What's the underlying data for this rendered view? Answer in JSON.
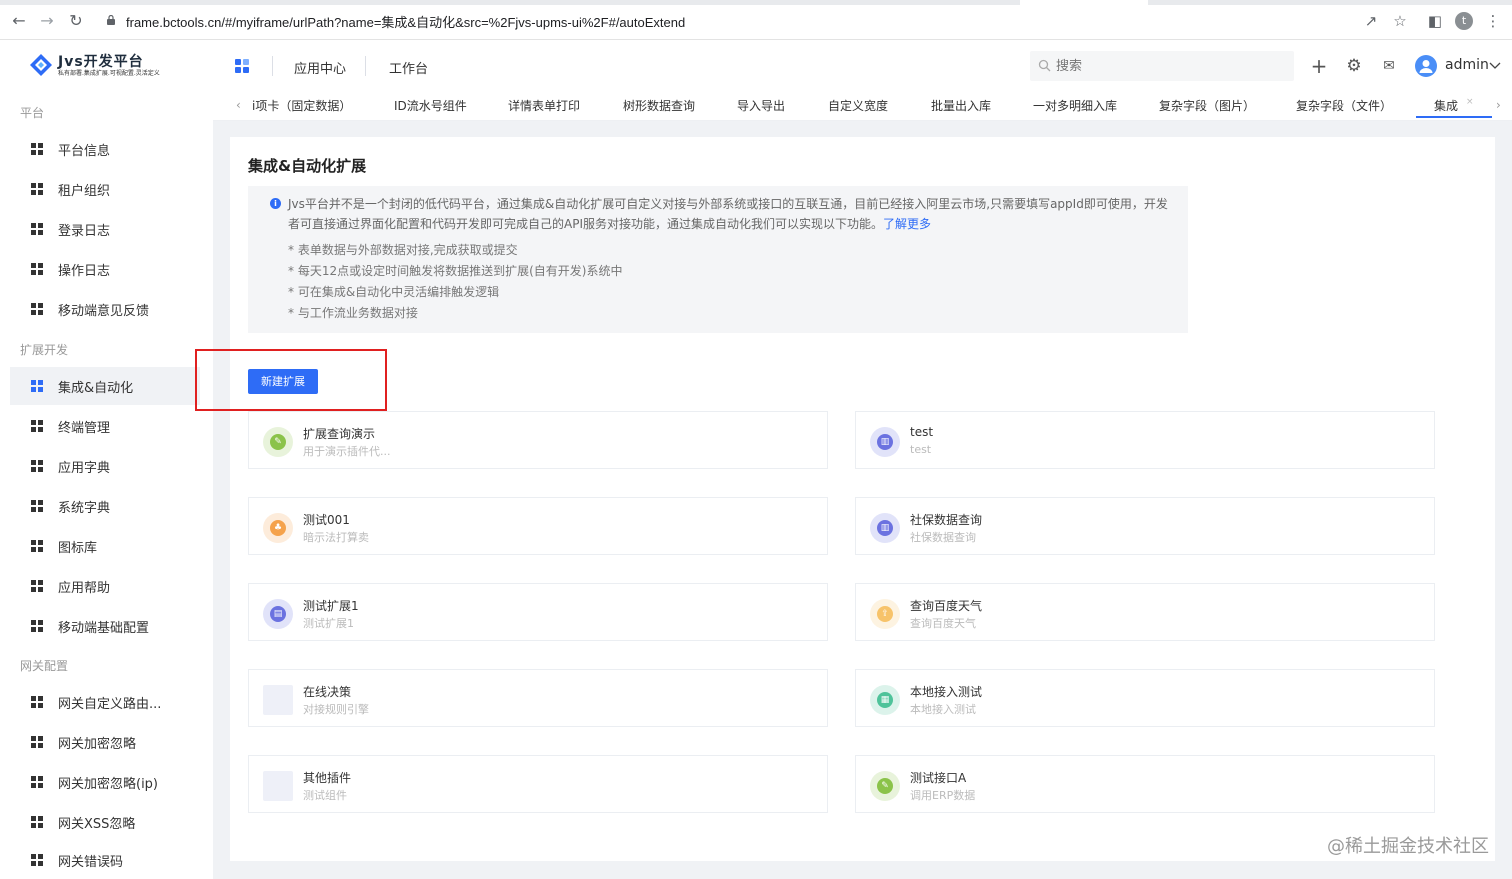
{
  "browser": {
    "url": "frame.bctools.cn/#/myiframe/urlPath?name=集成&自动化&src=%2Fjvs-upms-ui%2F#/autoExtend",
    "profile_initial": "t",
    "icons": [
      "back-icon",
      "forward-icon",
      "reload-icon",
      "lock-icon",
      "share-icon",
      "star-icon",
      "sidepanel-icon",
      "profile-icon",
      "menu-icon"
    ]
  },
  "header": {
    "logo_title": "Jvs开发平台",
    "logo_subtitle": "私有部署.集成扩展.可视配置.灵活定义",
    "nav": [
      "应用中心",
      "工作台"
    ],
    "search_placeholder": "搜索",
    "user_name": "admin",
    "icons": [
      "apps-icon",
      "plus-icon",
      "settings-icon",
      "message-icon",
      "avatar-icon",
      "chevron-down-icon"
    ]
  },
  "tabs": {
    "items": [
      "i项卡（固定数据）",
      "ID流水号组件",
      "详情表单打印",
      "树形数据查询",
      "导入导出",
      "自定义宽度",
      "批量出入库",
      "一对多明细入库",
      "复杂字段（图片）",
      "复杂字段（文件）",
      "集成"
    ],
    "active_index": 10,
    "close": "×"
  },
  "sidebar": {
    "groups": [
      {
        "title": "平台",
        "items": [
          "平台信息",
          "租户组织",
          "登录日志",
          "操作日志",
          "移动端意见反馈"
        ]
      },
      {
        "title": "扩展开发",
        "items": [
          "集成&自动化",
          "终端管理",
          "应用字典",
          "系统字典",
          "图标库",
          "应用帮助",
          "移动端基础配置"
        ]
      },
      {
        "title": "网关配置",
        "items": [
          "网关自定义路由...",
          "网关加密忽略",
          "网关加密忽略(ip)",
          "网关XSS忽略",
          "网关错误码"
        ]
      }
    ],
    "active_item": "集成&自动化"
  },
  "main": {
    "title": "集成&自动化扩展",
    "info": {
      "text": "Jvs平台并不是一个封闭的低代码平台，通过集成&自动化扩展可自定义对接与外部系统或接口的互联互通，目前已经接入阿里云市场,只需要填写appId即可使用，开发者可直接通过界面化配置和代码开发即可完成自己的API服务对接功能，通过集成自动化我们可以实现以下功能。",
      "link": "了解更多",
      "bullets": [
        "* 表单数据与外部数据对接,完成获取或提交",
        "* 每天12点或设定时间触发将数据推送到扩展(自有开发)系统中",
        "* 可在集成&自动化中灵活编排触发逻辑",
        "* 与工作流业务数据对接"
      ]
    },
    "new_button": "新建扩展",
    "cards": [
      {
        "name": "扩展查询演示",
        "desc": "用于演示插件代...",
        "color": "#8bc34a",
        "icon": "chat-icon",
        "glyph": "✎"
      },
      {
        "name": "test",
        "desc": "test",
        "color": "#6b72e0",
        "icon": "chart-icon",
        "glyph": "▥"
      },
      {
        "name": "测试001",
        "desc": "暗示法打算卖",
        "color": "#f5a24b",
        "icon": "people-icon",
        "glyph": "♣"
      },
      {
        "name": "社保数据查询",
        "desc": "社保数据查询",
        "color": "#6b72e0",
        "icon": "chart-icon",
        "glyph": "▥"
      },
      {
        "name": "测试扩展1",
        "desc": "测试扩展1",
        "color": "#6b72e0",
        "icon": "document-icon",
        "glyph": "▤"
      },
      {
        "name": "查询百度天气",
        "desc": "查询百度天气",
        "color": "#f7c36a",
        "icon": "upload-icon",
        "glyph": "⇪"
      },
      {
        "name": "在线决策",
        "desc": "对接规则引擎",
        "color": "",
        "icon": "blank-icon",
        "glyph": ""
      },
      {
        "name": "本地接入测试",
        "desc": "本地接入测试",
        "color": "#4fc39a",
        "icon": "grid-icon",
        "glyph": "▦"
      },
      {
        "name": "其他插件",
        "desc": "测试组件",
        "color": "",
        "icon": "blank-icon",
        "glyph": ""
      },
      {
        "name": "测试接口A",
        "desc": "调用ERP数据",
        "color": "#8bc34a",
        "icon": "chat-icon",
        "glyph": "✎"
      }
    ]
  },
  "watermark": "@稀土掘金技术社区"
}
